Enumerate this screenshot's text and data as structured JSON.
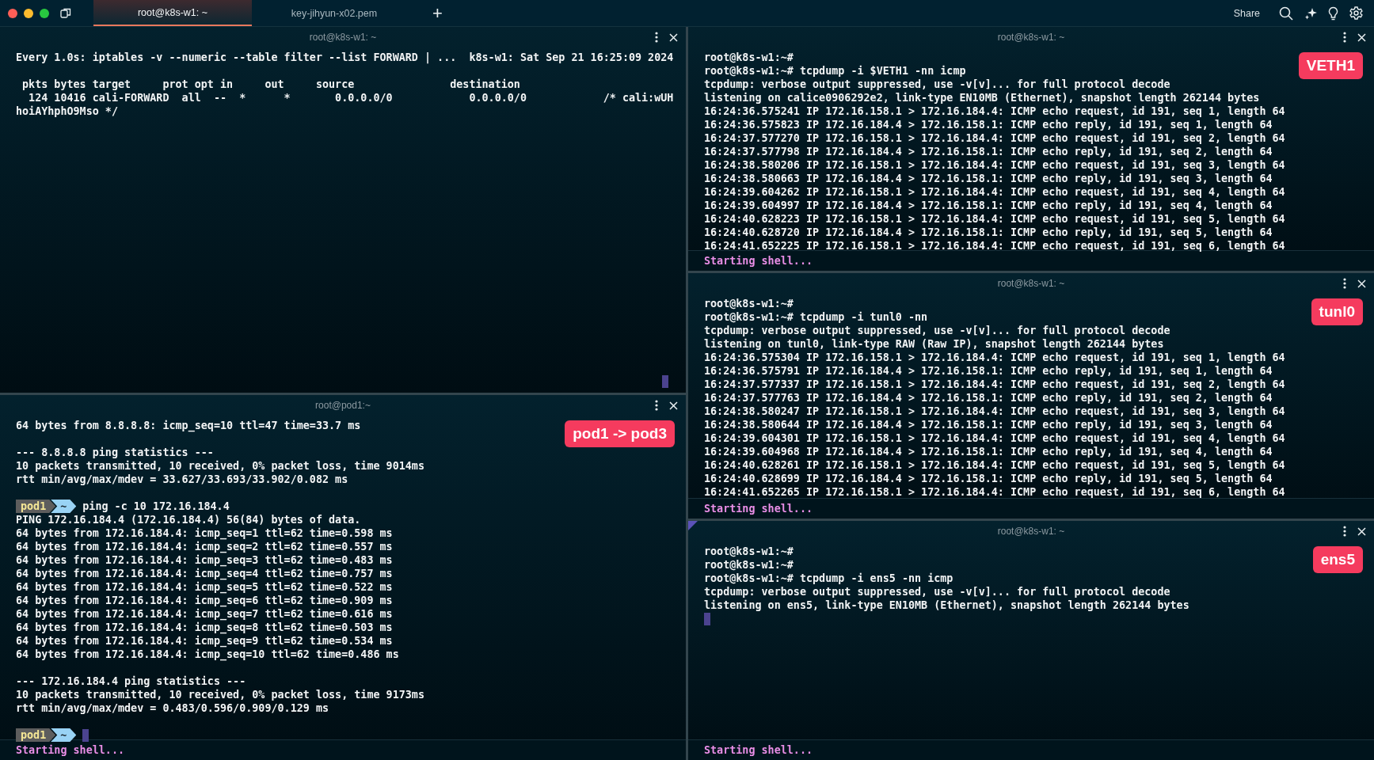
{
  "tabs": [
    {
      "title": "root@k8s-w1: ~",
      "selected": true
    },
    {
      "title": "key-jihyun-x02.pem",
      "selected": false
    }
  ],
  "new_tab": "+",
  "share": "Share",
  "columns": [
    {
      "panes": [
        {
          "title": "root@k8s-w1: ~",
          "focused": false,
          "corner_cursor": true,
          "lines": [
            {
              "kind": "text",
              "text": "Every 1.0s: iptables -v --numeric --table filter --list FORWARD | ...  k8s-w1: Sat Sep 21 16:25:09 2024"
            },
            {
              "kind": "blank"
            },
            {
              "kind": "text",
              "text": " pkts bytes target     prot opt in     out     source               destination"
            },
            {
              "kind": "text",
              "text": "  124 10416 cali-FORWARD  all  --  *      *       0.0.0.0/0            0.0.0.0/0            /* cali:wUH"
            },
            {
              "kind": "text",
              "text": "hoiAYhphO9Mso */"
            }
          ]
        },
        {
          "title": "root@pod1:~",
          "focused": false,
          "badge": "pod1 -> pod3",
          "footer": "Starting shell...",
          "lines": [
            {
              "kind": "text",
              "text": "64 bytes from 8.8.8.8: icmp_seq=10 ttl=47 time=33.7 ms"
            },
            {
              "kind": "blank"
            },
            {
              "kind": "text",
              "text": "--- 8.8.8.8 ping statistics ---"
            },
            {
              "kind": "text",
              "text": "10 packets transmitted, 10 received, 0% packet loss, time 9014ms"
            },
            {
              "kind": "text",
              "text": "rtt min/avg/max/mdev = 33.627/33.693/33.902/0.082 ms"
            },
            {
              "kind": "blank"
            },
            {
              "kind": "prompt",
              "host": "pod1",
              "dir": "~",
              "command": "ping -c 10 172.16.184.4",
              "cursor": false
            },
            {
              "kind": "text",
              "text": "PING 172.16.184.4 (172.16.184.4) 56(84) bytes of data."
            },
            {
              "kind": "text",
              "text": "64 bytes from 172.16.184.4: icmp_seq=1 ttl=62 time=0.598 ms"
            },
            {
              "kind": "text",
              "text": "64 bytes from 172.16.184.4: icmp_seq=2 ttl=62 time=0.557 ms"
            },
            {
              "kind": "text",
              "text": "64 bytes from 172.16.184.4: icmp_seq=3 ttl=62 time=0.483 ms"
            },
            {
              "kind": "text",
              "text": "64 bytes from 172.16.184.4: icmp_seq=4 ttl=62 time=0.757 ms"
            },
            {
              "kind": "text",
              "text": "64 bytes from 172.16.184.4: icmp_seq=5 ttl=62 time=0.522 ms"
            },
            {
              "kind": "text",
              "text": "64 bytes from 172.16.184.4: icmp_seq=6 ttl=62 time=0.909 ms"
            },
            {
              "kind": "text",
              "text": "64 bytes from 172.16.184.4: icmp_seq=7 ttl=62 time=0.616 ms"
            },
            {
              "kind": "text",
              "text": "64 bytes from 172.16.184.4: icmp_seq=8 ttl=62 time=0.503 ms"
            },
            {
              "kind": "text",
              "text": "64 bytes from 172.16.184.4: icmp_seq=9 ttl=62 time=0.534 ms"
            },
            {
              "kind": "text",
              "text": "64 bytes from 172.16.184.4: icmp_seq=10 ttl=62 time=0.486 ms"
            },
            {
              "kind": "blank"
            },
            {
              "kind": "text",
              "text": "--- 172.16.184.4 ping statistics ---"
            },
            {
              "kind": "text",
              "text": "10 packets transmitted, 10 received, 0% packet loss, time 9173ms"
            },
            {
              "kind": "text",
              "text": "rtt min/avg/max/mdev = 0.483/0.596/0.909/0.129 ms"
            },
            {
              "kind": "blank"
            },
            {
              "kind": "prompt",
              "host": "pod1",
              "dir": "~",
              "cursor": true
            }
          ]
        }
      ]
    },
    {
      "panes": [
        {
          "title": "root@k8s-w1: ~",
          "focused": false,
          "badge": "VETH1",
          "footer": "Starting shell...",
          "lines": [
            {
              "kind": "text",
              "text": "root@k8s-w1:~#"
            },
            {
              "kind": "text",
              "text": "root@k8s-w1:~# tcpdump -i $VETH1 -nn icmp"
            },
            {
              "kind": "text",
              "text": "tcpdump: verbose output suppressed, use -v[v]... for full protocol decode"
            },
            {
              "kind": "text",
              "text": "listening on calice0906292e2, link-type EN10MB (Ethernet), snapshot length 262144 bytes"
            },
            {
              "kind": "text",
              "text": "16:24:36.575241 IP 172.16.158.1 > 172.16.184.4: ICMP echo request, id 191, seq 1, length 64"
            },
            {
              "kind": "text",
              "text": "16:24:36.575823 IP 172.16.184.4 > 172.16.158.1: ICMP echo reply, id 191, seq 1, length 64"
            },
            {
              "kind": "text",
              "text": "16:24:37.577270 IP 172.16.158.1 > 172.16.184.4: ICMP echo request, id 191, seq 2, length 64"
            },
            {
              "kind": "text",
              "text": "16:24:37.577798 IP 172.16.184.4 > 172.16.158.1: ICMP echo reply, id 191, seq 2, length 64"
            },
            {
              "kind": "text",
              "text": "16:24:38.580206 IP 172.16.158.1 > 172.16.184.4: ICMP echo request, id 191, seq 3, length 64"
            },
            {
              "kind": "text",
              "text": "16:24:38.580663 IP 172.16.184.4 > 172.16.158.1: ICMP echo reply, id 191, seq 3, length 64"
            },
            {
              "kind": "text",
              "text": "16:24:39.604262 IP 172.16.158.1 > 172.16.184.4: ICMP echo request, id 191, seq 4, length 64"
            },
            {
              "kind": "text",
              "text": "16:24:39.604997 IP 172.16.184.4 > 172.16.158.1: ICMP echo reply, id 191, seq 4, length 64"
            },
            {
              "kind": "text",
              "text": "16:24:40.628223 IP 172.16.158.1 > 172.16.184.4: ICMP echo request, id 191, seq 5, length 64"
            },
            {
              "kind": "text",
              "text": "16:24:40.628720 IP 172.16.184.4 > 172.16.158.1: ICMP echo reply, id 191, seq 5, length 64"
            },
            {
              "kind": "text",
              "text": "16:24:41.652225 IP 172.16.158.1 > 172.16.184.4: ICMP echo request, id 191, seq 6, length 64"
            }
          ]
        },
        {
          "title": "root@k8s-w1: ~",
          "focused": false,
          "badge": "tunl0",
          "footer": "Starting shell...",
          "lines": [
            {
              "kind": "text",
              "text": "root@k8s-w1:~#"
            },
            {
              "kind": "text",
              "text": "root@k8s-w1:~# tcpdump -i tunl0 -nn"
            },
            {
              "kind": "text",
              "text": "tcpdump: verbose output suppressed, use -v[v]... for full protocol decode"
            },
            {
              "kind": "text",
              "text": "listening on tunl0, link-type RAW (Raw IP), snapshot length 262144 bytes"
            },
            {
              "kind": "text",
              "text": "16:24:36.575304 IP 172.16.158.1 > 172.16.184.4: ICMP echo request, id 191, seq 1, length 64"
            },
            {
              "kind": "text",
              "text": "16:24:36.575791 IP 172.16.184.4 > 172.16.158.1: ICMP echo reply, id 191, seq 1, length 64"
            },
            {
              "kind": "text",
              "text": "16:24:37.577337 IP 172.16.158.1 > 172.16.184.4: ICMP echo request, id 191, seq 2, length 64"
            },
            {
              "kind": "text",
              "text": "16:24:37.577763 IP 172.16.184.4 > 172.16.158.1: ICMP echo reply, id 191, seq 2, length 64"
            },
            {
              "kind": "text",
              "text": "16:24:38.580247 IP 172.16.158.1 > 172.16.184.4: ICMP echo request, id 191, seq 3, length 64"
            },
            {
              "kind": "text",
              "text": "16:24:38.580644 IP 172.16.184.4 > 172.16.158.1: ICMP echo reply, id 191, seq 3, length 64"
            },
            {
              "kind": "text",
              "text": "16:24:39.604301 IP 172.16.158.1 > 172.16.184.4: ICMP echo request, id 191, seq 4, length 64"
            },
            {
              "kind": "text",
              "text": "16:24:39.604968 IP 172.16.184.4 > 172.16.158.1: ICMP echo reply, id 191, seq 4, length 64"
            },
            {
              "kind": "text",
              "text": "16:24:40.628261 IP 172.16.158.1 > 172.16.184.4: ICMP echo request, id 191, seq 5, length 64"
            },
            {
              "kind": "text",
              "text": "16:24:40.628699 IP 172.16.184.4 > 172.16.158.1: ICMP echo reply, id 191, seq 5, length 64"
            },
            {
              "kind": "text",
              "text": "16:24:41.652265 IP 172.16.158.1 > 172.16.184.4: ICMP echo request, id 191, seq 6, length 64"
            }
          ]
        },
        {
          "title": "root@k8s-w1: ~",
          "focused": true,
          "badge": "ens5",
          "footer": "Starting shell...",
          "lines": [
            {
              "kind": "text",
              "text": "root@k8s-w1:~#"
            },
            {
              "kind": "text",
              "text": "root@k8s-w1:~#"
            },
            {
              "kind": "text",
              "text": "root@k8s-w1:~# tcpdump -i ens5 -nn icmp"
            },
            {
              "kind": "text",
              "text": "tcpdump: verbose output suppressed, use -v[v]... for full protocol decode"
            },
            {
              "kind": "text",
              "text": "listening on ens5, link-type EN10MB (Ethernet), snapshot length 262144 bytes"
            },
            {
              "kind": "cursor"
            }
          ]
        }
      ]
    }
  ]
}
